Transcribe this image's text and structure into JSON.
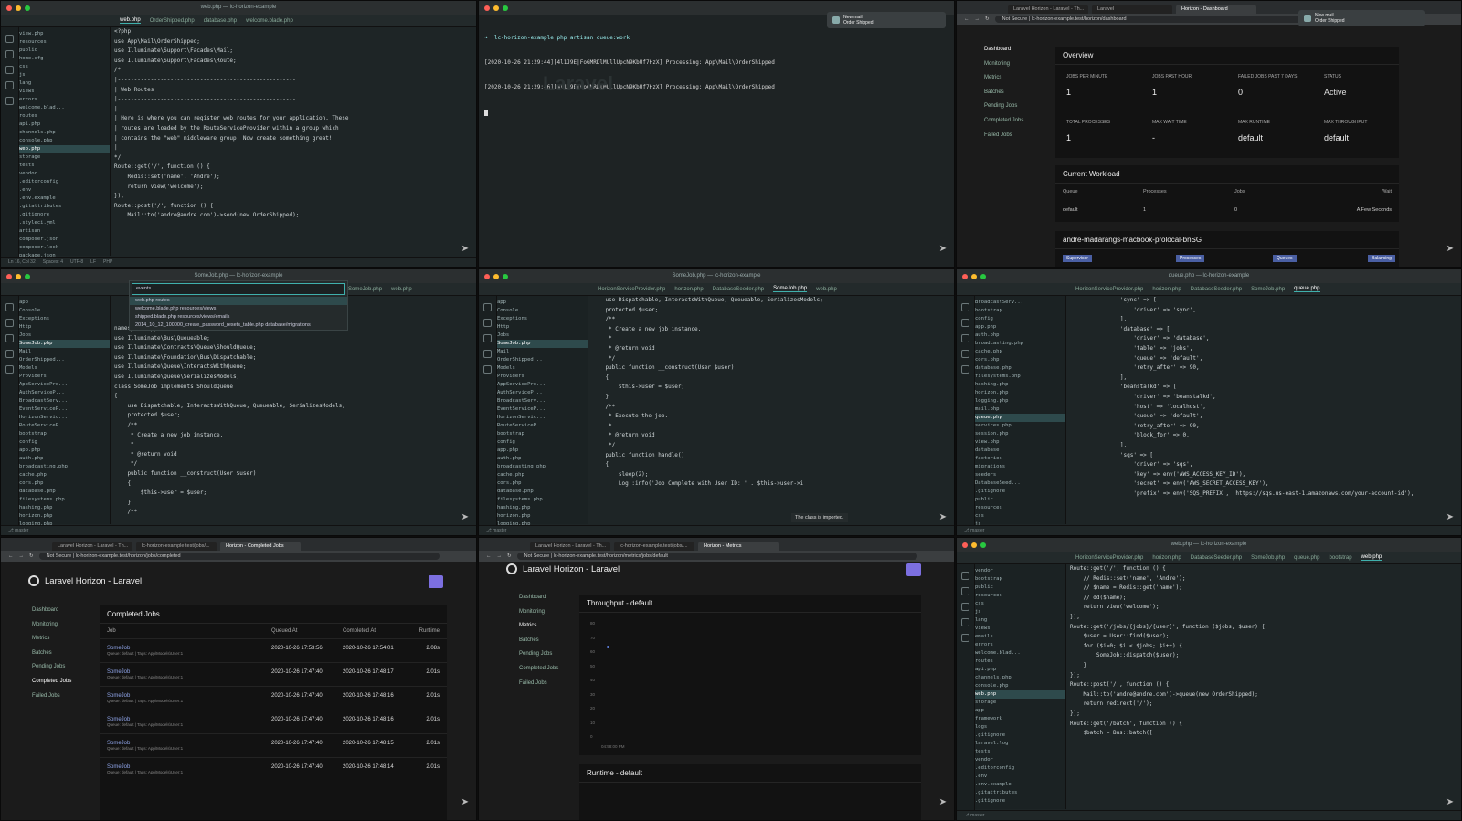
{
  "p1": {
    "title": "web.php — lc-horizon-example",
    "tabs": [
      "web.php",
      "OrderShipped.php",
      "database.php",
      "welcome.blade.php"
    ],
    "tree": [
      "view.php",
      "resources",
      "public",
      "home.cfg",
      "css",
      "js",
      "lang",
      "views",
      "errors",
      "welcome.blad...",
      "routes",
      "api.php",
      "channels.php",
      "console.php",
      "web.php",
      "storage",
      "tests",
      "vendor",
      ".editorconfig",
      ".env",
      ".env.example",
      ".gitattributes",
      ".gitignore",
      ".styleci.yml",
      "artisan",
      "composer.json",
      "composer.lock",
      "package.json",
      "phpunit.xml"
    ],
    "code": [
      "<?php",
      "",
      "use App\\Mail\\OrderShipped;",
      "use Illuminate\\Support\\Facades\\Mail;",
      "use Illuminate\\Support\\Facades\\Route;",
      "",
      "/*",
      "|------------------------------------------------------",
      "| Web Routes",
      "|------------------------------------------------------",
      "|",
      "| Here is where you can register web routes for your application. These",
      "| routes are loaded by the RouteServiceProvider within a group which",
      "| contains the \"web\" middleware group. Now create something great!",
      "|",
      "*/",
      "",
      "Route::get('/', function () {",
      "    Redis::set('name', 'Andre');",
      "",
      "    return view('welcome');",
      "});",
      "",
      "Route::post('/', function () {",
      "    Mail::to('andre@andre.com')->send(new OrderShipped);"
    ],
    "status": [
      "Ln 16, Col 32",
      "Spaces: 4",
      "UTF-8",
      "LF",
      "PHP"
    ]
  },
  "p2": {
    "title": "lc-horizon-example",
    "prompt": "➜  lc-horizon-example php artisan queue:work",
    "lines": [
      "[2020-10-26 21:29:44][4l1J9E|FoGMRDlMUllUpcN9KbUf7HzX] Processing: App\\Mail\\OrderShipped",
      "[2020-10-26 21:29:46][4l1J9E|FoGMRDlMUllUpcN9KbUf7HzX] Processing: App\\Mail\\OrderShipped"
    ],
    "notif": [
      "New mail",
      "Order Shipped"
    ],
    "ghost": "Laravel"
  },
  "p3": {
    "tabs": [
      "Laravel Horizon - Laravel - Th...",
      "Laravel",
      "Horizon - Dashboard"
    ],
    "url": "Not Secure  |  lc-horizon-example.test/horizon/dashboard",
    "notif": [
      "New mail",
      "Order Shipped"
    ],
    "nav": [
      "Dashboard",
      "Monitoring",
      "Metrics",
      "Batches",
      "Pending Jobs",
      "Completed Jobs",
      "Failed Jobs"
    ],
    "overview": "Overview",
    "metrics": [
      {
        "label": "JOBS PER MINUTE",
        "value": "1"
      },
      {
        "label": "JOBS PAST HOUR",
        "value": "1"
      },
      {
        "label": "FAILED JOBS PAST 7 DAYS",
        "value": "0"
      },
      {
        "label": "STATUS",
        "value": "Active"
      },
      {
        "label": "TOTAL PROCESSES",
        "value": "1"
      },
      {
        "label": "MAX WAIT TIME",
        "value": "-"
      },
      {
        "label": "MAX RUNTIME",
        "value": "default"
      },
      {
        "label": "MAX THROUGHPUT",
        "value": "default"
      }
    ],
    "workload": "Current Workload",
    "wl_head": [
      "Queue",
      "Processes",
      "Jobs",
      "Wait"
    ],
    "wl_row": [
      "default",
      "1",
      "0",
      "A Few Seconds"
    ],
    "host": "andre-madarangs-macbook-prolocal-bnSG",
    "pills": [
      "Supervisor",
      "Processes",
      "Queues",
      "Balancing"
    ]
  },
  "p4": {
    "title": "SomeJob.php — lc-horizon-example",
    "search": "events",
    "results": [
      "web.php  routes",
      "welcome.blade.php  resources/views",
      "shipped.blade.php  resources/views/emails",
      "2014_10_12_100000_create_password_resets_table.php  database/migrations"
    ],
    "code": [
      "namespace App\\Jobs;",
      "",
      "use Illuminate\\Bus\\Queueable;",
      "use Illuminate\\Contracts\\Queue\\ShouldQueue;",
      "use Illuminate\\Foundation\\Bus\\Dispatchable;",
      "use Illuminate\\Queue\\InteractsWithQueue;",
      "use Illuminate\\Queue\\SerializesModels;",
      "",
      "class SomeJob implements ShouldQueue",
      "{",
      "    use Dispatchable, InteractsWithQueue, Queueable, SerializesModels;",
      "",
      "    protected $user;",
      "",
      "    /**",
      "     * Create a new job instance.",
      "     *",
      "     * @return void",
      "     */",
      "    public function __construct(User $user)",
      "    {",
      "        $this->user = $user;",
      "    }",
      "",
      "    /**"
    ],
    "tree": [
      "app",
      "Console",
      "Exceptions",
      "Http",
      "Jobs",
      "SomeJob.php",
      "Mail",
      "OrderShipped...",
      "Models",
      "Providers",
      "AppServicePro...",
      "AuthServiceP...",
      "BroadcastServ...",
      "EventServiceP...",
      "HorizonServic...",
      "RouteServiceP...",
      "bootstrap",
      "config",
      "app.php",
      "auth.php",
      "broadcasting.php",
      "cache.php",
      "cors.php",
      "database.php",
      "filesystems.php",
      "hashing.php",
      "horizon.php",
      "logging.php",
      "mail.php"
    ]
  },
  "p5": {
    "title": "SomeJob.php — lc-horizon-example",
    "tabs": [
      "HorizonServiceProvider.php",
      "horizon.php",
      "DatabaseSeeder.php",
      "SomeJob.php",
      "web.php"
    ],
    "code": [
      "",
      "    use Dispatchable, InteractsWithQueue, Queueable, SerializesModels;",
      "",
      "    protected $user;",
      "",
      "    /**",
      "     * Create a new job instance.",
      "     *",
      "     * @return void",
      "     */",
      "    public function __construct(User $user)",
      "    {",
      "        $this->user = $user;",
      "    }",
      "",
      "    /**",
      "     * Execute the job.",
      "     *",
      "     * @return void",
      "     */",
      "    public function handle()",
      "    {",
      "        sleep(2);",
      "        Log::info('Job Complete with User ID: ' . $this->user->i"
    ],
    "hint": "The class is imported.",
    "tree": [
      "app",
      "Console",
      "Exceptions",
      "Http",
      "Jobs",
      "SomeJob.php",
      "Mail",
      "OrderShipped...",
      "Models",
      "Providers",
      "AppServicePro...",
      "AuthServiceP...",
      "BroadcastServ...",
      "EventServiceP...",
      "HorizonServic...",
      "RouteServiceP...",
      "bootstrap",
      "config",
      "app.php",
      "auth.php",
      "broadcasting.php",
      "cache.php",
      "cors.php",
      "database.php",
      "filesystems.php",
      "hashing.php",
      "horizon.php",
      "logging.php",
      "mail.php"
    ]
  },
  "p6": {
    "title": "queue.php — lc-horizon-example",
    "tabs": [
      "HorizonServiceProvider.php",
      "horizon.php",
      "DatabaseSeeder.php",
      "SomeJob.php",
      "queue.php"
    ],
    "code": [
      "        'sync' => [",
      "            'driver' => 'sync',",
      "        ],",
      "",
      "        'database' => [",
      "            'driver' => 'database',",
      "            'table' => 'jobs',",
      "            'queue' => 'default',",
      "            'retry_after' => 90,",
      "        ],",
      "",
      "        'beanstalkd' => [",
      "            'driver' => 'beanstalkd',",
      "            'host' => 'localhost',",
      "            'queue' => 'default',",
      "            'retry_after' => 90,",
      "            'block_for' => 0,",
      "        ],",
      "",
      "        'sqs' => [",
      "            'driver' => 'sqs',",
      "            'key' => env('AWS_ACCESS_KEY_ID'),",
      "            'secret' => env('AWS_SECRET_ACCESS_KEY'),",
      "            'prefix' => env('SQS_PREFIX', 'https://sqs.us-east-1.amazonaws.com/your-account-id'),"
    ],
    "tree": [
      "BroadcastServ...",
      "bootstrap",
      "config",
      "app.php",
      "auth.php",
      "broadcasting.php",
      "cache.php",
      "cors.php",
      "database.php",
      "filesystems.php",
      "hashing.php",
      "horizon.php",
      "logging.php",
      "mail.php",
      "queue.php",
      "services.php",
      "session.php",
      "view.php",
      "database",
      "factories",
      "migrations",
      "seeders",
      "DatabaseSeed...",
      ".gitignore",
      "public",
      "resources",
      "css",
      "js",
      "lang"
    ]
  },
  "p7": {
    "tabs": [
      "Laravel Horizon - Laravel - Th...",
      "lc-horizon-example.test/jobs/...",
      "Horizon - Completed Jobs"
    ],
    "url": "Not Secure  |  lc-horizon-example.test/horizon/jobs/completed",
    "app_title": "Laravel Horizon - Laravel",
    "nav": [
      "Dashboard",
      "Monitoring",
      "Metrics",
      "Batches",
      "Pending Jobs",
      "Completed Jobs",
      "Failed Jobs"
    ],
    "card_title": "Completed Jobs",
    "head": [
      "Job",
      "Queued At",
      "Completed At",
      "Runtime"
    ],
    "rows": [
      {
        "job": "SomeJob",
        "sub": "Queue: default | Tags: App\\Models\\User:1",
        "queued": "2020-10-26 17:53:56",
        "completed": "2020-10-26 17:54:01",
        "runtime": "2.08s"
      },
      {
        "job": "SomeJob",
        "sub": "Queue: default | Tags: App\\Models\\User:1",
        "queued": "2020-10-26 17:47:40",
        "completed": "2020-10-26 17:48:17",
        "runtime": "2.01s"
      },
      {
        "job": "SomeJob",
        "sub": "Queue: default | Tags: App\\Models\\User:1",
        "queued": "2020-10-26 17:47:40",
        "completed": "2020-10-26 17:48:16",
        "runtime": "2.01s"
      },
      {
        "job": "SomeJob",
        "sub": "Queue: default | Tags: App\\Models\\User:1",
        "queued": "2020-10-26 17:47:40",
        "completed": "2020-10-26 17:48:16",
        "runtime": "2.01s"
      },
      {
        "job": "SomeJob",
        "sub": "Queue: default | Tags: App\\Models\\User:1",
        "queued": "2020-10-26 17:47:40",
        "completed": "2020-10-26 17:48:15",
        "runtime": "2.01s"
      },
      {
        "job": "SomeJob",
        "sub": "Queue: default | Tags: App\\Models\\User:1",
        "queued": "2020-10-26 17:47:40",
        "completed": "2020-10-26 17:48:14",
        "runtime": "2.01s"
      }
    ]
  },
  "p8": {
    "tabs": [
      "Laravel Horizon - Laravel - Th...",
      "lc-horizon-example.test/jobs/...",
      "Horizon - Metrics"
    ],
    "url": "Not Secure  |  lc-horizon-example.test/horizon/metrics/jobs/default",
    "app_title": "Laravel Horizon - Laravel",
    "nav": [
      "Dashboard",
      "Monitoring",
      "Metrics",
      "Batches",
      "Pending Jobs",
      "Completed Jobs",
      "Failed Jobs"
    ],
    "throughput": "Throughput - default",
    "runtime": "Runtime - default",
    "yticks": [
      "80",
      "70",
      "60",
      "50",
      "40",
      "30",
      "20",
      "10",
      "0"
    ],
    "xtick": "04:58:00 PM"
  },
  "p9": {
    "title": "web.php — lc-horizon-example",
    "tabs": [
      "HorizonServiceProvider.php",
      "horizon.php",
      "DatabaseSeeder.php",
      "SomeJob.php",
      "queue.php",
      "bootstrap",
      "web.php"
    ],
    "code": [
      "Route::get('/', function () {",
      "    // Redis::set('name', 'Andre');",
      "    // $name = Redis::get('name');",
      "",
      "    // dd($name);",
      "",
      "    return view('welcome');",
      "});",
      "",
      "Route::get('/jobs/{jobs}/{user}', function ($jobs, $user) {",
      "    $user = User::find($user);",
      "",
      "    for ($i=0; $i < $jobs; $i++) {",
      "        SomeJob::dispatch($user);",
      "    }",
      "});",
      "",
      "Route::post('/', function () {",
      "    Mail::to('andre@andre.com')->queue(new OrderShipped);",
      "",
      "    return redirect('/');",
      "});",
      "",
      "Route::get('/batch', function () {",
      "    $batch = Bus::batch(["
    ],
    "tree": [
      "vendor",
      "bootstrap",
      "public",
      "resources",
      "css",
      "js",
      "lang",
      "views",
      "emails",
      "errors",
      "welcome.blad...",
      "routes",
      "api.php",
      "channels.php",
      "console.php",
      "web.php",
      "storage",
      "app",
      "framework",
      "logs",
      ".gitignore",
      "laravel.log",
      "tests",
      "vendor",
      ".editorconfig",
      ".env",
      ".env.example",
      ".gitattributes",
      ".gitignore"
    ]
  }
}
